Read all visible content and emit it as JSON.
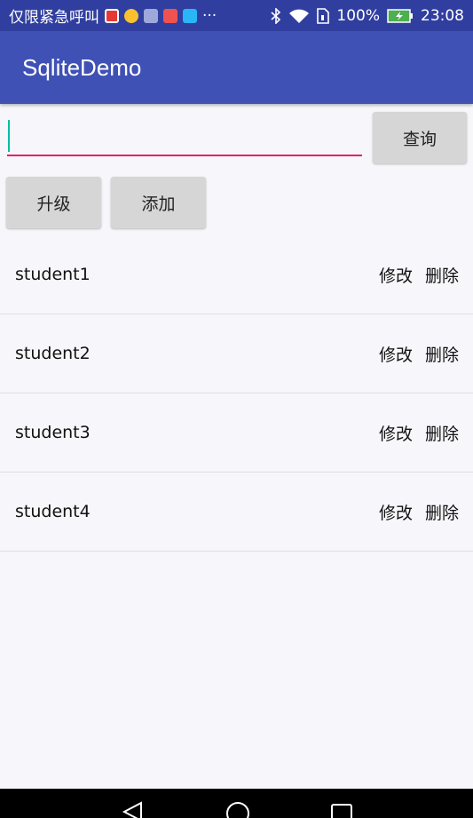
{
  "status_bar": {
    "left_text": "仅限紧急呼叫",
    "more": "···",
    "battery": "100%",
    "time": "23:08"
  },
  "app_bar": {
    "title": "SqliteDemo"
  },
  "search": {
    "value": "",
    "button_label": "查询"
  },
  "actions": {
    "upgrade_label": "升级",
    "add_label": "添加"
  },
  "students": [
    {
      "name": "student1",
      "edit_label": "修改",
      "delete_label": "删除"
    },
    {
      "name": "student2",
      "edit_label": "修改",
      "delete_label": "删除"
    },
    {
      "name": "student3",
      "edit_label": "修改",
      "delete_label": "删除"
    },
    {
      "name": "student4",
      "edit_label": "修改",
      "delete_label": "删除"
    }
  ],
  "colors": {
    "primary": "#3f51b5",
    "primary_dark": "#303f9f",
    "accent": "#e91e63",
    "cursor": "#00bfa5"
  }
}
